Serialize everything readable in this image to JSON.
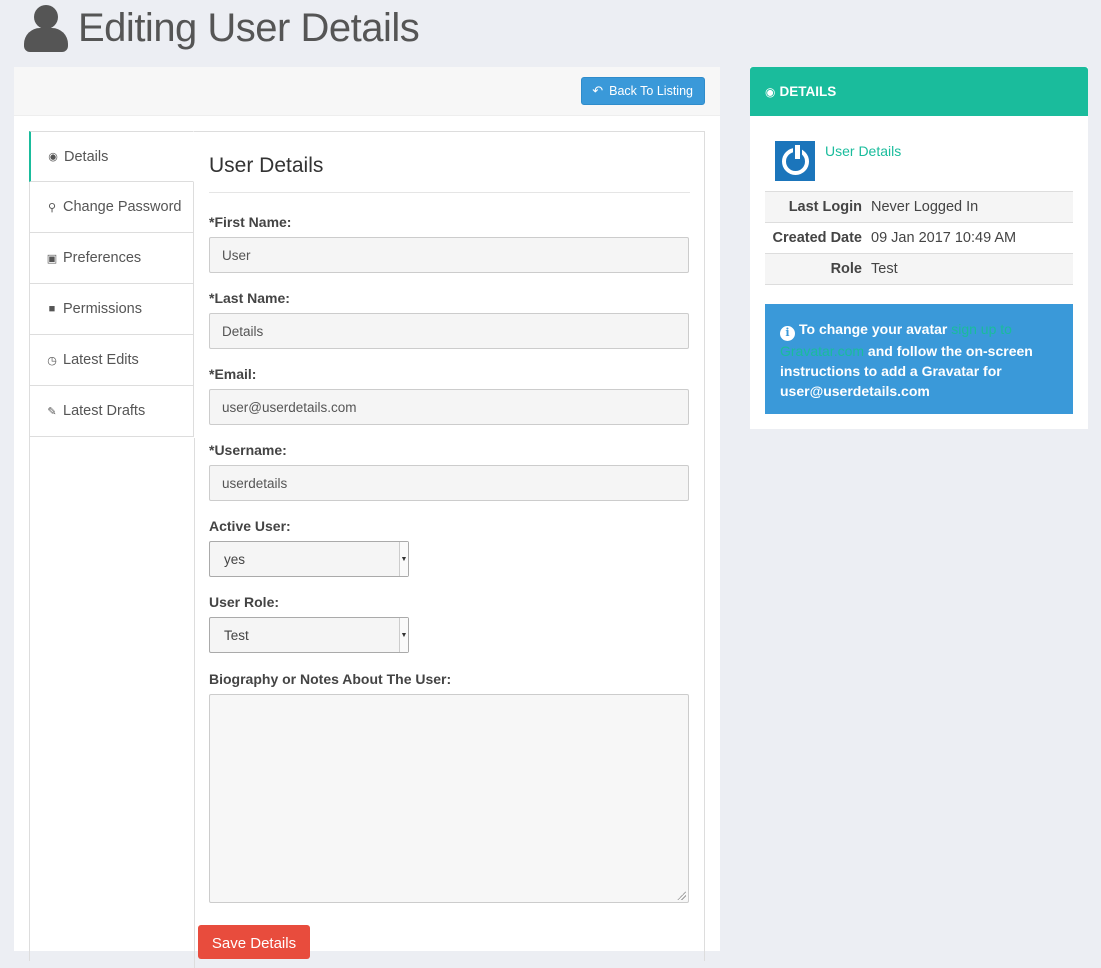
{
  "page": {
    "title": "Editing User Details"
  },
  "toolbar": {
    "back_label": "Back To Listing"
  },
  "tabs": [
    {
      "label": "Details",
      "icon": "eye-icon"
    },
    {
      "label": "Change Password",
      "icon": "key-icon"
    },
    {
      "label": "Preferences",
      "icon": "briefcase-icon"
    },
    {
      "label": "Permissions",
      "icon": "lock-icon"
    },
    {
      "label": "Latest Edits",
      "icon": "clock-icon"
    },
    {
      "label": "Latest Drafts",
      "icon": "pencil-icon"
    }
  ],
  "form": {
    "heading": "User Details",
    "first_name": {
      "label": "*First Name:",
      "value": "User"
    },
    "last_name": {
      "label": "*Last Name:",
      "value": "Details"
    },
    "email": {
      "label": "*Email:",
      "value": "user@userdetails.com"
    },
    "username": {
      "label": "*Username:",
      "value": "userdetails"
    },
    "active": {
      "label": "Active User:",
      "value": "yes"
    },
    "role": {
      "label": "User Role:",
      "value": "Test"
    },
    "bio": {
      "label": "Biography or Notes About The User:",
      "value": ""
    },
    "save_label": "Save Details"
  },
  "details_panel": {
    "title": "DETAILS",
    "user_link": "User Details",
    "rows": [
      {
        "key": "Last Login",
        "value": "Never Logged In"
      },
      {
        "key": "Created Date",
        "value": "09 Jan 2017 10:49 AM"
      },
      {
        "key": "Role",
        "value": "Test"
      }
    ],
    "alert": {
      "text_start": "To change your avatar",
      "link": "sign up to Gravatar.com",
      "text_end": "and follow the on-screen instructions to add a Gravatar for user@userdetails.com"
    }
  },
  "colors": {
    "accent": "#1abc9c",
    "primary": "#3a99d9",
    "danger": "#e84c3d",
    "avatar": "#1b75bb"
  }
}
